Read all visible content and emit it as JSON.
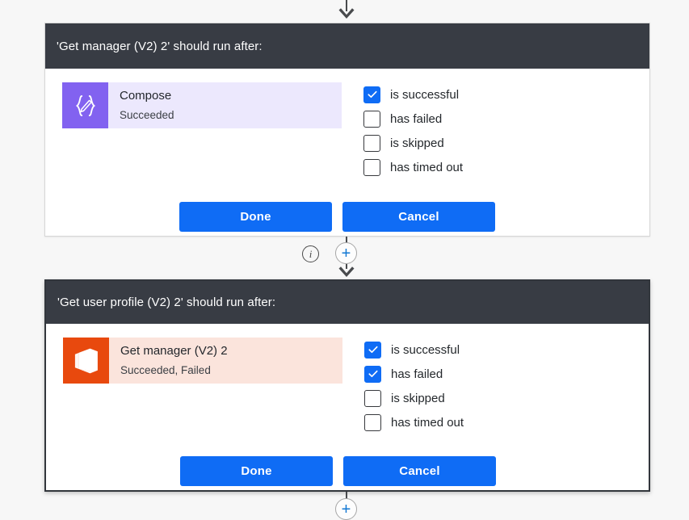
{
  "canvas": {
    "background_color": "#f7f7f7",
    "accent_blue": "#0f6cf5",
    "header_dark": "#383c44"
  },
  "connectors": {
    "top_arrow_icon": "arrow-down-icon",
    "middle_info_icon": "info-icon",
    "middle_plus_label": "+",
    "middle_arrow_icon": "arrow-down-icon",
    "bottom_plus_label": "+"
  },
  "cards": [
    {
      "id": "run-after-get-manager",
      "header": "'Get manager (V2) 2' should run after:",
      "selected": false,
      "action": {
        "icon_name": "compose-icon",
        "icon_glyph": "{✐}",
        "icon_color": "#8262f0",
        "chip_background": "#ece8fd",
        "title": "Compose",
        "status": "Succeeded"
      },
      "conditions": [
        {
          "label": "is successful",
          "checked": true
        },
        {
          "label": "has failed",
          "checked": false
        },
        {
          "label": "is skipped",
          "checked": false
        },
        {
          "label": "has timed out",
          "checked": false
        }
      ],
      "buttons": {
        "primary": "Done",
        "secondary": "Cancel"
      }
    },
    {
      "id": "run-after-get-user-profile",
      "header": "'Get user profile (V2) 2' should run after:",
      "selected": true,
      "action": {
        "icon_name": "office365-icon",
        "icon_glyph": "",
        "icon_color": "#e8490e",
        "chip_background": "#fbe4dc",
        "title": "Get manager (V2) 2",
        "status": "Succeeded, Failed"
      },
      "conditions": [
        {
          "label": "is successful",
          "checked": true
        },
        {
          "label": "has failed",
          "checked": true
        },
        {
          "label": "is skipped",
          "checked": false
        },
        {
          "label": "has timed out",
          "checked": false
        }
      ],
      "buttons": {
        "primary": "Done",
        "secondary": "Cancel"
      }
    }
  ]
}
